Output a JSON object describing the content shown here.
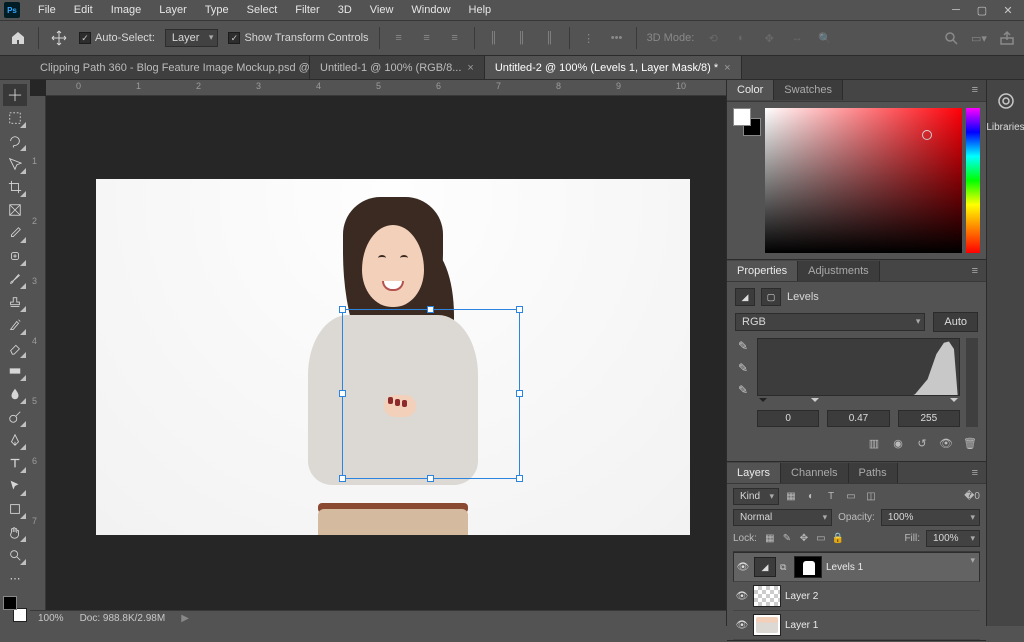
{
  "menu": {
    "items": [
      "File",
      "Edit",
      "Image",
      "Layer",
      "Type",
      "Select",
      "Filter",
      "3D",
      "View",
      "Window",
      "Help"
    ]
  },
  "options": {
    "auto_select_label": "Auto-Select:",
    "auto_select_target": "Layer",
    "show_transform_label": "Show Transform Controls",
    "mode3d_label": "3D Mode:"
  },
  "tabs": [
    {
      "title": "Clipping Path 360 - Blog Feature Image Mockup.psd @ ...",
      "active": false
    },
    {
      "title": "Untitled-1 @ 100% (RGB/8...",
      "active": false
    },
    {
      "title": "Untitled-2 @ 100% (Levels 1, Layer Mask/8) *",
      "active": true
    }
  ],
  "ruler": {
    "h": [
      "0",
      "1",
      "2",
      "3",
      "4",
      "5",
      "6",
      "7",
      "8",
      "9",
      "10"
    ],
    "v": [
      "1",
      "2",
      "3",
      "4",
      "5",
      "6",
      "7"
    ]
  },
  "status": {
    "zoom": "100%",
    "doc": "Doc: 988.8K/2.98M"
  },
  "panels": {
    "color": {
      "tabs": [
        "Color",
        "Swatches"
      ]
    },
    "properties": {
      "tabs": [
        "Properties",
        "Adjustments"
      ],
      "type_label": "Levels",
      "channel": "RGB",
      "auto": "Auto",
      "levels": {
        "black": "0",
        "mid": "0.47",
        "white": "255"
      }
    },
    "layers": {
      "tabs": [
        "Layers",
        "Channels",
        "Paths"
      ],
      "kind": "Kind",
      "blend": "Normal",
      "opacity_label": "Opacity:",
      "opacity": "100%",
      "lock_label": "Lock:",
      "fill_label": "Fill:",
      "fill": "100%",
      "items": [
        {
          "name": "Levels 1"
        },
        {
          "name": "Layer 2"
        },
        {
          "name": "Layer 1"
        }
      ]
    },
    "libraries": "Libraries"
  }
}
